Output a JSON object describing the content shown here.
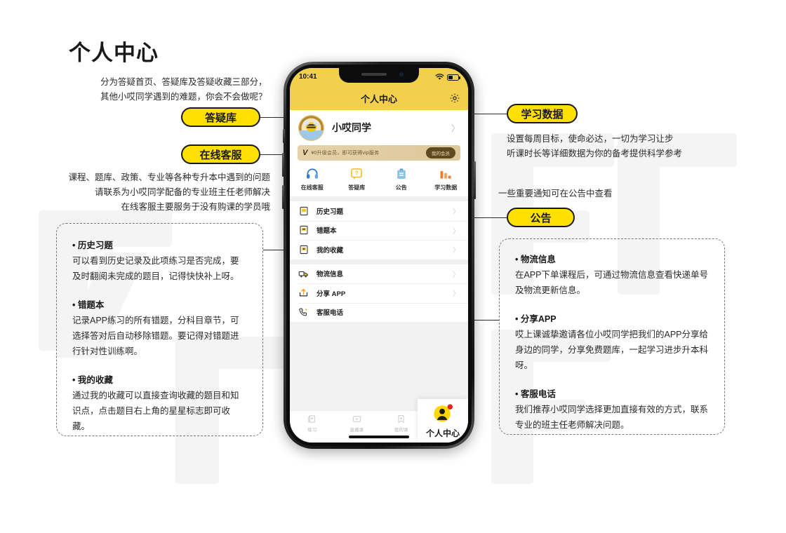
{
  "page": {
    "title": "个人中心"
  },
  "intro": {
    "line1": "分为答疑首页、答疑库及答疑收藏三部分，",
    "line2": "其他小哎同学遇到的难题，你会不会做呢？"
  },
  "left_desc": {
    "line1": "课程、题库、政策、专业等各种专升本中遇到的问题",
    "line2": "请联系为小哎同学配备的专业班主任老师解决",
    "line3": "在线客服主要服务于没有购课的学员哦"
  },
  "pills": {
    "qa_library": "答疑库",
    "online_service": "在线客服",
    "study_data": "学习数据",
    "announcement": "公告"
  },
  "right_desc": {
    "study_line1": "设置每周目标，使命必达，一切为学习让步",
    "study_line2": "听课时长等详细数据为你的备考提供科学参考",
    "announce_line1": "一些重要通知可在公告中查看"
  },
  "left_notes": [
    {
      "title": "历史习题",
      "body": "可以看到历史记录及此项练习是否完成，要及时翻阅未完成的题目，记得快快补上呀。"
    },
    {
      "title": "错题本",
      "body": "记录APP练习的所有错题，分科目章节，可选择答对后自动移除错题。要记得对错题进行针对性训练啊。"
    },
    {
      "title": "我的收藏",
      "body": "通过我的收藏可以直接查询收藏的题目和知识点，点击题目右上角的星星标志即可收藏。"
    }
  ],
  "right_notes": [
    {
      "title": "物流信息",
      "body": "在APP下单课程后，可通过物流信息查看快递单号及物流更新信息。"
    },
    {
      "title": "分享APP",
      "body": "哎上课诚挚邀请各位小哎同学把我们的APP分享给身边的同学，分享免费题库，一起学习进步升本科呀。"
    },
    {
      "title": "客服电话",
      "body": "我们推荐小哎同学选择更加直接有效的方式，联系专业的班主任老师解决问题。"
    }
  ],
  "phone": {
    "status": {
      "time": "10:41",
      "wifi_icon": "wifi-icon",
      "battery_icon": "battery-icon"
    },
    "appbar": {
      "title": "个人中心",
      "settings_icon": "gear-icon"
    },
    "profile": {
      "username": "小哎同学",
      "avatar_icon": "bee-avatar",
      "chevron": "〉"
    },
    "vip_banner": {
      "logo": "V",
      "text": "¥0升级会员，即可获得vip服务",
      "button": "我的会员"
    },
    "quick_actions": [
      {
        "label": "在线客服",
        "icon": "headset-icon",
        "color": "#2F7BD6"
      },
      {
        "label": "答疑库",
        "icon": "question-bubble-icon",
        "color": "#F2C02E"
      },
      {
        "label": "公告",
        "icon": "clipboard-icon",
        "color": "#8FC3E6"
      },
      {
        "label": "学习数据",
        "icon": "bar-chart-icon",
        "color": "#F07B28"
      }
    ],
    "menu_group_1": [
      {
        "label": "历史习题",
        "icon": "history-paper-icon",
        "chevron": "〉"
      },
      {
        "label": "错题本",
        "icon": "wrong-book-icon",
        "chevron": "〉"
      },
      {
        "label": "我的收藏",
        "icon": "star-collect-icon",
        "chevron": "〉"
      }
    ],
    "menu_group_2": [
      {
        "label": "物流信息",
        "icon": "truck-icon",
        "chevron": "〉"
      },
      {
        "label": "分享 APP",
        "icon": "share-icon",
        "chevron": "〉"
      },
      {
        "label": "客服电话",
        "icon": "phone-icon",
        "chevron": ""
      }
    ],
    "tabs": [
      {
        "label": "练习",
        "icon": "practice-icon",
        "active": false
      },
      {
        "label": "直播课",
        "icon": "live-class-icon",
        "active": false
      },
      {
        "label": "我的课",
        "icon": "my-class-icon",
        "active": false
      },
      {
        "label": "个人中心",
        "icon": "profile-icon",
        "active": true
      }
    ]
  },
  "colors": {
    "brand_yellow": "#FFE000",
    "app_yellow": "#F2D04B",
    "dot_red": "#E8231A",
    "text_dark": "#1a1a1a"
  }
}
